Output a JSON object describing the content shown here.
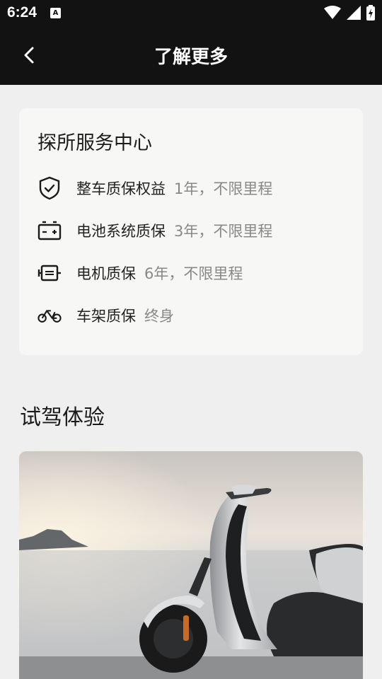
{
  "status_bar": {
    "time": "6:24",
    "notification_badge": "A"
  },
  "app_bar": {
    "title": "了解更多",
    "back_icon": "chevron-left-icon"
  },
  "card": {
    "title": "探所服务中心",
    "rows": [
      {
        "icon": "shield-check-icon",
        "label": "整车质保权益",
        "value": "1年，不限里程"
      },
      {
        "icon": "battery-icon",
        "label": "电池系统质保",
        "value": "3年，不限里程"
      },
      {
        "icon": "motor-icon",
        "label": "电机质保",
        "value": "6年，不限里程"
      },
      {
        "icon": "bicycle-icon",
        "label": "车架质保",
        "value": "终身"
      }
    ]
  },
  "test_ride": {
    "title": "试驾体验",
    "image": "scooter-by-the-sea-photo"
  },
  "colors": {
    "bar_background": "#121212",
    "page_background": "#efefef",
    "card_background": "#f7f7f6",
    "muted_text": "#888888"
  }
}
